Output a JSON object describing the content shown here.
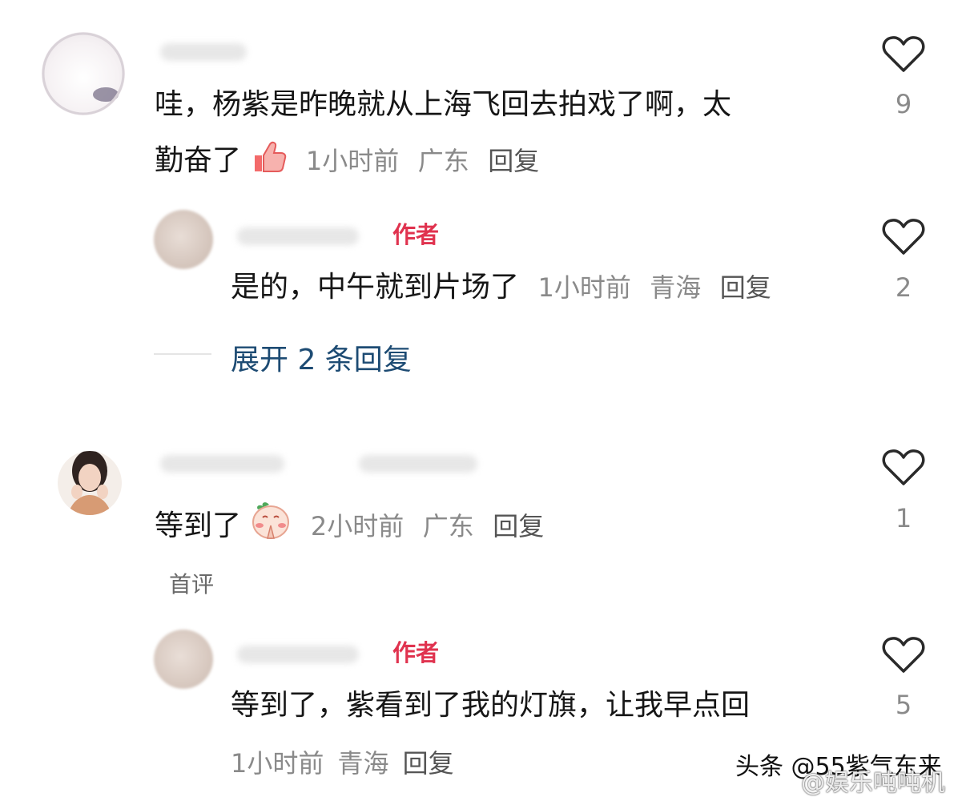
{
  "comments": [
    {
      "text_line1": "哇，杨紫是昨晚就从上海飞回去拍戏了啊，太",
      "text_line2": "勤奋了",
      "time": "1小时前",
      "location": "广东",
      "reply_label": "回复",
      "likes": "9"
    },
    {
      "author_tag": "作者",
      "text": "是的，中午就到片场了",
      "time": "1小时前",
      "location": "青海",
      "reply_label": "回复",
      "likes": "2"
    },
    {
      "text": "等到了",
      "time": "2小时前",
      "location": "广东",
      "reply_label": "回复",
      "likes": "1",
      "badge": "首评"
    },
    {
      "author_tag": "作者",
      "text": "等到了，紫看到了我的灯旗，让我早点回",
      "time": "1小时前",
      "location": "青海",
      "reply_label": "回复",
      "likes": "5"
    }
  ],
  "expand_replies": "展开 2 条回复",
  "watermark": {
    "line1": "头条 @55紫气东来",
    "line2": "@娱乐吨吨机"
  },
  "colors": {
    "author_tag": "#e0334f",
    "expand_link": "#1d4b73",
    "meta_gray": "#8a8a8a"
  },
  "icons": [
    "heart-outline-icon",
    "thumbs-up-emoji",
    "pray-emoji"
  ]
}
